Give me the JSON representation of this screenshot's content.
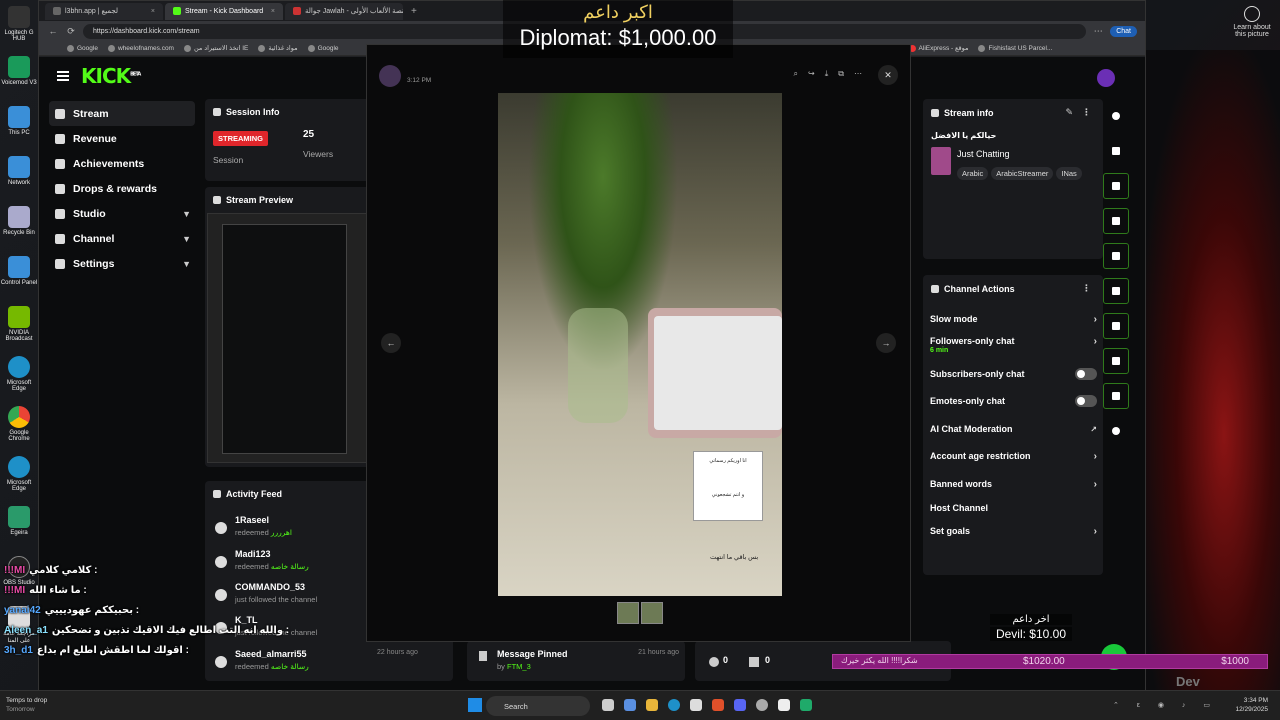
{
  "browser": {
    "tabs": [
      {
        "label": "l3bhn.app | لجميع"
      },
      {
        "label": "Stream - Kick Dashboard"
      },
      {
        "label": "جوالة Jawlah - منصة الألعاب الأولى"
      }
    ],
    "url": "https://dashboard.kick.com/stream",
    "bookmarks": [
      "Google",
      "wheelofnames.com",
      "اتخذ الاستيراد من IE",
      "مواد غذائية",
      "Google",
      "AliExpress - موقع",
      "Fishisfast US Parcel..."
    ],
    "chat_button": "Chat"
  },
  "desktop": {
    "icons": [
      "Logitech G HUB",
      "Voicemod V3",
      "This PC",
      "Network",
      "Recycle Bin",
      "Control Panel",
      "NVIDIA Broadcast",
      "Microsoft Edge",
      "Google Chrome",
      "Microsoft Edge",
      "Egeira",
      "OBS Studio",
      "مراجعة عامة على المنا"
    ],
    "learn_about": "Learn about this picture"
  },
  "kick": {
    "logo": "KICK",
    "logo_badge": "BETA",
    "nav": [
      {
        "label": "Stream"
      },
      {
        "label": "Revenue"
      },
      {
        "label": "Achievements"
      },
      {
        "label": "Drops & rewards"
      },
      {
        "label": "Studio"
      },
      {
        "label": "Channel"
      },
      {
        "label": "Settings"
      }
    ],
    "session_info": {
      "title": "Session Info",
      "badge": "STREAMING",
      "session_label": "Session",
      "viewers": "25",
      "viewers_label": "Viewers"
    },
    "stream_preview": {
      "title": "Stream Preview"
    },
    "activity_feed": {
      "title": "Activity Feed",
      "items": [
        {
          "name": "1Raseel",
          "action": "redeemed",
          "reward": "اهرررر"
        },
        {
          "name": "Madi123",
          "action": "redeemed",
          "reward": "رسالة خاصه"
        },
        {
          "name": "COMMANDO_53",
          "action": "just followed the channel",
          "reward": ""
        },
        {
          "name": "K_TL",
          "action": "just followed the channel",
          "reward": ""
        },
        {
          "name": "Saeed_almarri55",
          "action": "redeemed",
          "reward": "رسالة خاصه",
          "time": "22 hours ago"
        }
      ]
    },
    "pinned": {
      "label": "Message Pinned",
      "by": "by",
      "user": "FTM_3",
      "time": "21 hours ago"
    },
    "stats_bar": {
      "users": "0",
      "gifts": "0"
    },
    "stream_info": {
      "title": "Stream info",
      "stream_title": "حيالكم يا الافضل",
      "category": "Just Chatting",
      "tags": [
        "Arabic",
        "ArabicStreamer",
        "INas"
      ]
    },
    "channel_actions": {
      "title": "Channel Actions",
      "rows": [
        {
          "label": "Slow mode",
          "control": "arrow"
        },
        {
          "label": "Followers-only chat",
          "sub": "6 min",
          "control": "arrow"
        },
        {
          "label": "Subscribers-only chat",
          "control": "toggle"
        },
        {
          "label": "Emotes-only chat",
          "control": "toggle"
        },
        {
          "label": "AI Chat Moderation",
          "control": "external"
        },
        {
          "label": "Account age restriction",
          "control": "arrow"
        },
        {
          "label": "Banned words",
          "control": "arrow"
        },
        {
          "label": "Host Channel",
          "control": "none"
        },
        {
          "label": "Set goals",
          "control": "arrow"
        }
      ]
    }
  },
  "viewer": {
    "time": "3:12 PM",
    "caption": "بس باقي ما انتهت",
    "sticker_top": "انا اوريكم رسماتي",
    "sticker_bottom": "و انتم تشجعوني"
  },
  "overlay": {
    "top_donor_ar": "اكبر داعم",
    "top_donor": "Diplomat: $1,000.00",
    "last_donor_ar": "اخر داعم",
    "last_donor": "Devil: $10.00",
    "goal_left": "شكرا!!!! الله يكثر خيرك",
    "goal_mid": "$1020.00",
    "goal_right": "$1000",
    "watermark": "Dev"
  },
  "chat_overlay": [
    {
      "user": "!!!MI",
      "text": "كلامي كلامي :"
    },
    {
      "user": "!!!MI",
      "text": "ما شاء الله :"
    },
    {
      "user": "yanai42",
      "text": "بحبيككم عهوديييي :"
    },
    {
      "user": "Aleen_a1",
      "text": "والله انه التت اطالع فيك الاقيك تذبين و تضحكين :"
    },
    {
      "user": "3h_d1",
      "text": "اقولك لما اطقش اطلع ام بداع :"
    }
  ],
  "taskbar": {
    "weather": "Temps to drop",
    "weather_sub": "Tomorrow",
    "search": "Search",
    "time": "3:34 PM",
    "date": "12/29/2025"
  }
}
